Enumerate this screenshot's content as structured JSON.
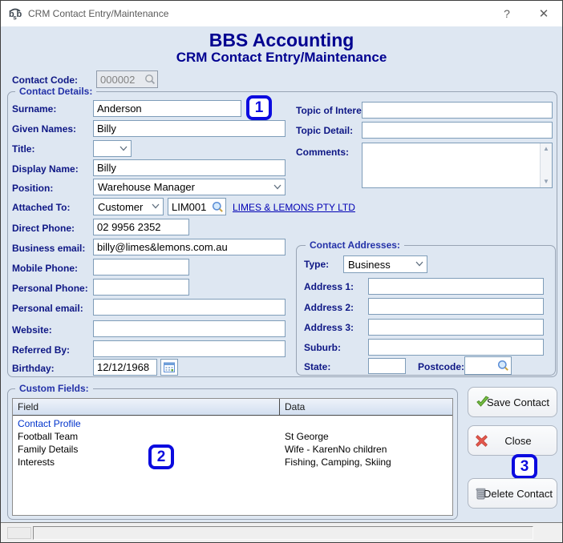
{
  "window": {
    "title": "CRM Contact Entry/Maintenance",
    "help_label": "?",
    "close_label": "✕"
  },
  "header": {
    "app_title": "BBS Accounting",
    "screen_title": "CRM Contact Entry/Maintenance"
  },
  "contact_code": {
    "label": "Contact Code:",
    "value": "000002"
  },
  "contact_details": {
    "group_label": "Contact Details:",
    "surname": {
      "label": "Surname:",
      "value": "Anderson"
    },
    "given_names": {
      "label": "Given Names:",
      "value": "Billy"
    },
    "title": {
      "label": "Title:",
      "value": ""
    },
    "display_name": {
      "label": "Display Name:",
      "value": "Billy"
    },
    "position": {
      "label": "Position:",
      "value": "Warehouse Manager"
    },
    "attached_to": {
      "label": "Attached To:",
      "type_value": "Customer",
      "code_value": "LIM001",
      "link_text": "LIMES & LEMONS PTY LTD"
    },
    "direct_phone": {
      "label": "Direct Phone:",
      "value": "02 9956 2352"
    },
    "business_email": {
      "label": "Business email:",
      "value": "billy@limes&lemons.com.au"
    },
    "mobile_phone": {
      "label": "Mobile Phone:",
      "value": ""
    },
    "personal_phone": {
      "label": "Personal Phone:",
      "value": ""
    },
    "personal_email": {
      "label": "Personal email:",
      "value": ""
    },
    "website": {
      "label": "Website:",
      "value": ""
    },
    "referred_by": {
      "label": "Referred By:",
      "value": ""
    },
    "birthday": {
      "label": "Birthday:",
      "value": "12/12/1968"
    },
    "topic_of_interest": {
      "label": "Topic of Interest:",
      "value": ""
    },
    "topic_detail": {
      "label": "Topic Detail:",
      "value": ""
    },
    "comments": {
      "label": "Comments:",
      "value": ""
    }
  },
  "contact_addresses": {
    "group_label": "Contact Addresses:",
    "type": {
      "label": "Type:",
      "value": "Business"
    },
    "address1": {
      "label": "Address 1:",
      "value": ""
    },
    "address2": {
      "label": "Address 2:",
      "value": ""
    },
    "address3": {
      "label": "Address 3:",
      "value": ""
    },
    "suburb": {
      "label": "Suburb:",
      "value": ""
    },
    "state": {
      "label": "State:",
      "value": ""
    },
    "postcode": {
      "label": "Postcode:",
      "value": ""
    }
  },
  "custom_fields": {
    "group_label": "Custom Fields:",
    "columns": {
      "field": "Field",
      "data": "Data"
    },
    "rows": [
      {
        "field": "Contact Profile",
        "data": ""
      },
      {
        "field": "Football Team",
        "data": "St George"
      },
      {
        "field": "Family Details",
        "data": "Wife - KarenNo children"
      },
      {
        "field": "Interests",
        "data": "Fishing, Camping, Skiing"
      }
    ]
  },
  "buttons": {
    "save": "Save Contact",
    "close": "Close",
    "delete": "Delete Contact"
  },
  "annotations": {
    "badge1": "1",
    "badge2": "2",
    "badge3": "3"
  },
  "colors": {
    "header_navy": "#000090",
    "label_navy": "#0e1785",
    "group_label_blue": "#2432a8",
    "badge_blue": "#0b0bdf",
    "link_blue": "#0000b4",
    "save_green": "#76c043",
    "close_red": "#e2574c",
    "content_bg": "#dee7f2"
  }
}
